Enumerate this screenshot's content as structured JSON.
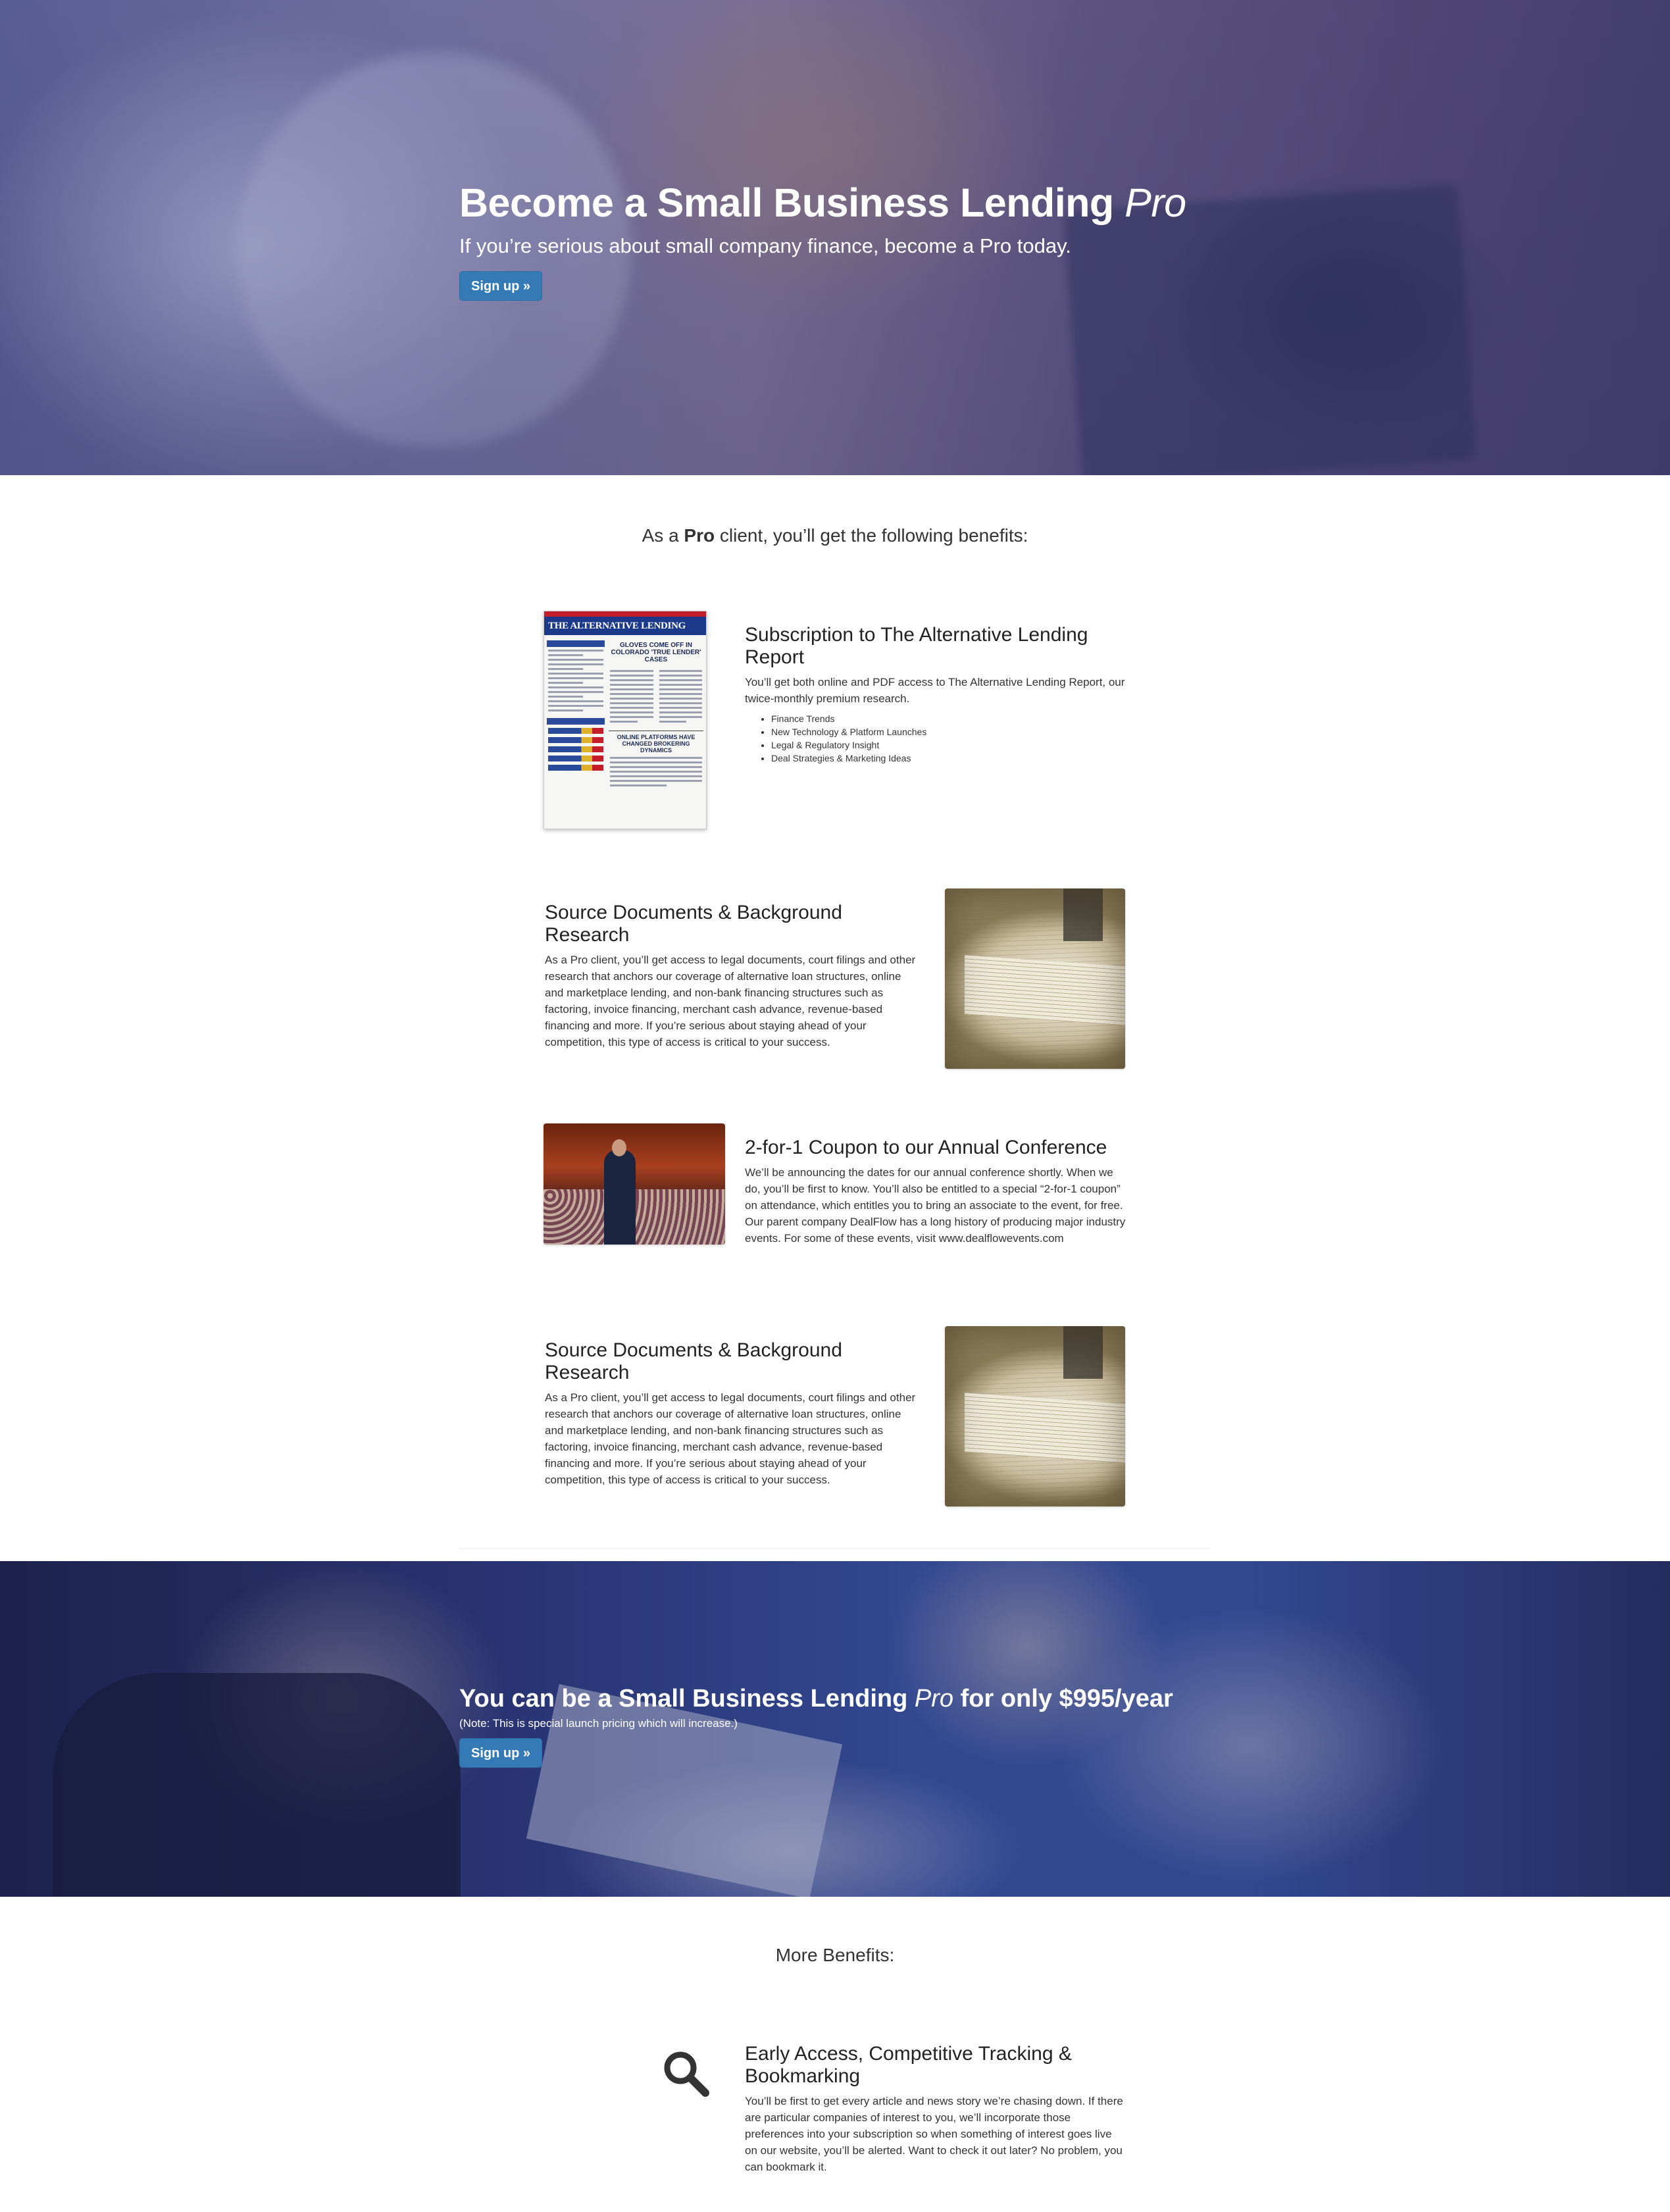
{
  "hero": {
    "title_main": "Become a Small Business Lending",
    "title_em": "Pro",
    "subtitle": "If you’re serious about small company finance, become a Pro today.",
    "signup_label": "Sign up »"
  },
  "benefits": {
    "intro_pre": "As a",
    "intro_strong": "Pro",
    "intro_post": "client, you’ll get the following benefits:",
    "items": [
      {
        "title": "Subscription to The Alternative Lending Report",
        "text": "You’ll get both online and PDF access to The Alternative Lending Report, our twice-monthly premium research.",
        "bullets": [
          "Finance Trends",
          "New Technology & Platform Launches",
          "Legal & Regulatory Insight",
          "Deal Strategies & Marketing Ideas"
        ],
        "image": {
          "masthead": "THE ALTERNATIVE LENDING REPORT",
          "headline": "GLOVES COME OFF IN COLORADO 'TRUE LENDER' CASES",
          "headline2": "ONLINE PLATFORMS HAVE CHANGED BROKERING DYNAMICS"
        }
      },
      {
        "title": "Source Documents & Background Research",
        "text": "As a Pro client, you’ll get access to legal documents, court filings and other research that anchors our coverage of alternative loan structures, online and marketplace lending, and non-bank financing structures such as factoring, invoice financing, merchant cash advance, revenue-based financing and more. If you’re serious about staying ahead of your competition, this type of access is critical to your success."
      },
      {
        "title": "2-for-1 Coupon to our Annual Conference",
        "text": "We’ll be announcing the dates for our annual conference shortly. When we do, you’ll be first to know. You’ll also be entitled to a special “2-for-1 coupon” on attendance, which entitles you to bring an associate to the event, for free. Our parent company DealFlow has a long history of producing major industry events. For some of these events, visit www.dealflowevents.com"
      },
      {
        "title": "Source Documents & Background Research",
        "text": "As a Pro client, you’ll get access to legal documents, court filings and other research that anchors our coverage of alternative loan structures, online and marketplace lending, and non-bank financing structures such as factoring, invoice financing, merchant cash advance, revenue-based financing and more. If you’re serious about staying ahead of your competition, this type of access is critical to your success."
      }
    ]
  },
  "cta": {
    "title_pre": "You can be a Small Business Lending",
    "title_em": "Pro",
    "title_post": "for only $995/year",
    "note": "(Note: This is special launch pricing which will increase.)",
    "signup_label": "Sign up »"
  },
  "more": {
    "heading": "More Benefits:",
    "items": [
      {
        "icon": "search-icon",
        "title": "Early Access, Competitive Tracking & Bookmarking",
        "text": "You’ll be first to get every article and news story we’re chasing down. If there are particular companies of interest to you, we’ll incorporate those preferences into your subscription so when something of interest goes live on our website, you’ll be alerted. Want to check it out later? No problem, you can bookmark it."
      }
    ]
  },
  "colors": {
    "primary_button": "#337ab7",
    "text": "#333333",
    "heading": "#222222"
  }
}
